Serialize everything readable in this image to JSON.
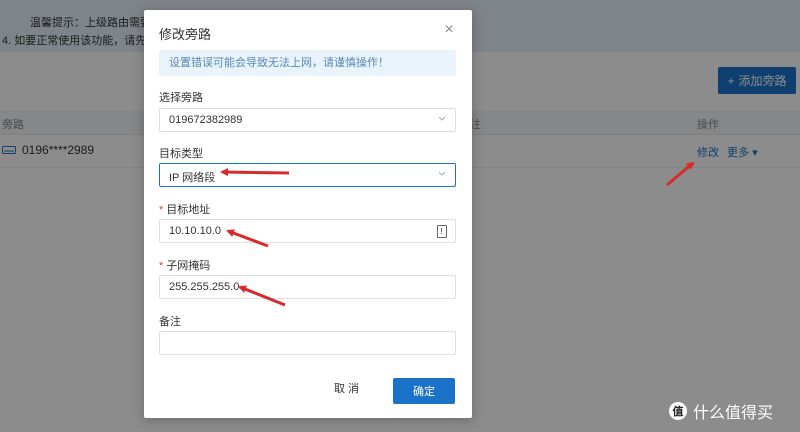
{
  "background": {
    "notice_line_1": "如要正常使用该功能，请先升级",
    "notice_line_2": "温馨提示：上级路由需要添加",
    "add_button_label": "添加旁路",
    "table_headers": {
      "bypass": "旁路",
      "note": "注",
      "action": "操作"
    },
    "row": {
      "device": "0196****2989",
      "edit_link": "修改",
      "more_link": "更多"
    }
  },
  "modal": {
    "title": "修改旁路",
    "warning": "设置错误可能会导致无法上网，请谨慎操作！",
    "select_bypass": {
      "label": "选择旁路",
      "value": "019672382989"
    },
    "target_type": {
      "label": "目标类型",
      "value": "IP 网络段"
    },
    "target_address": {
      "label": "目标地址",
      "value": "10.10.10.0"
    },
    "subnet_mask": {
      "label": "子网掩码",
      "value": "255.255.255.0"
    },
    "note": {
      "label": "备注",
      "value": ""
    },
    "cancel_label": "取 消",
    "ok_label": "确定"
  },
  "watermark": {
    "text": "什么值得买",
    "logo_text": "值"
  },
  "colors": {
    "primary": "#1a73c9",
    "annotation_arrow": "#d62b2b",
    "required": "#e0392e"
  }
}
